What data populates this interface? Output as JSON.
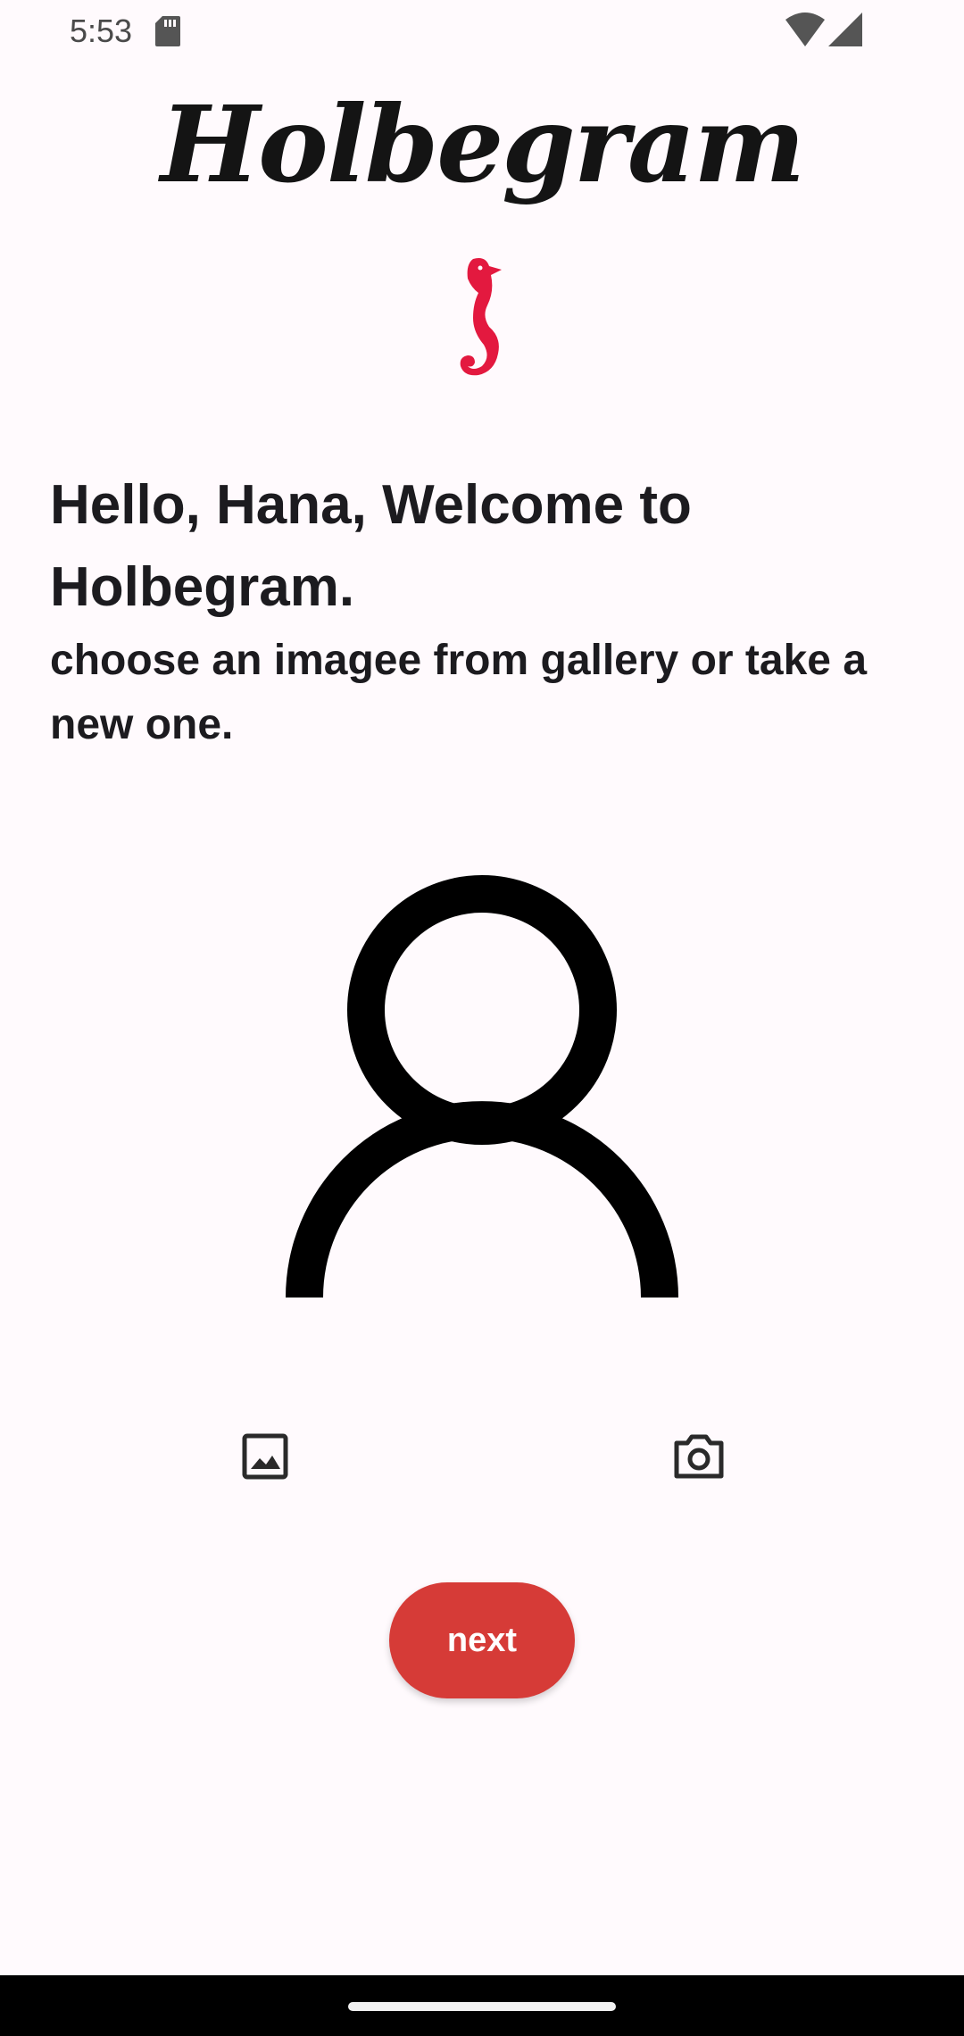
{
  "status_bar": {
    "time": "5:53",
    "icons": [
      "sd-card-icon",
      "wifi-icon",
      "cellular-signal-icon"
    ]
  },
  "header": {
    "app_name": "Holbegram",
    "logo_icon": "seahorse-icon",
    "logo_color": "#e3193f"
  },
  "main": {
    "greeting": "Hello, Hana, Welcome to Holbegram.",
    "instructions": "choose an imagee from gallery or take a new one.",
    "avatar_icon": "person-outline-icon",
    "gallery_icon": "image-gallery-icon",
    "camera_icon": "camera-icon"
  },
  "actions": {
    "next_label": "next",
    "next_color": "#d63b37"
  }
}
